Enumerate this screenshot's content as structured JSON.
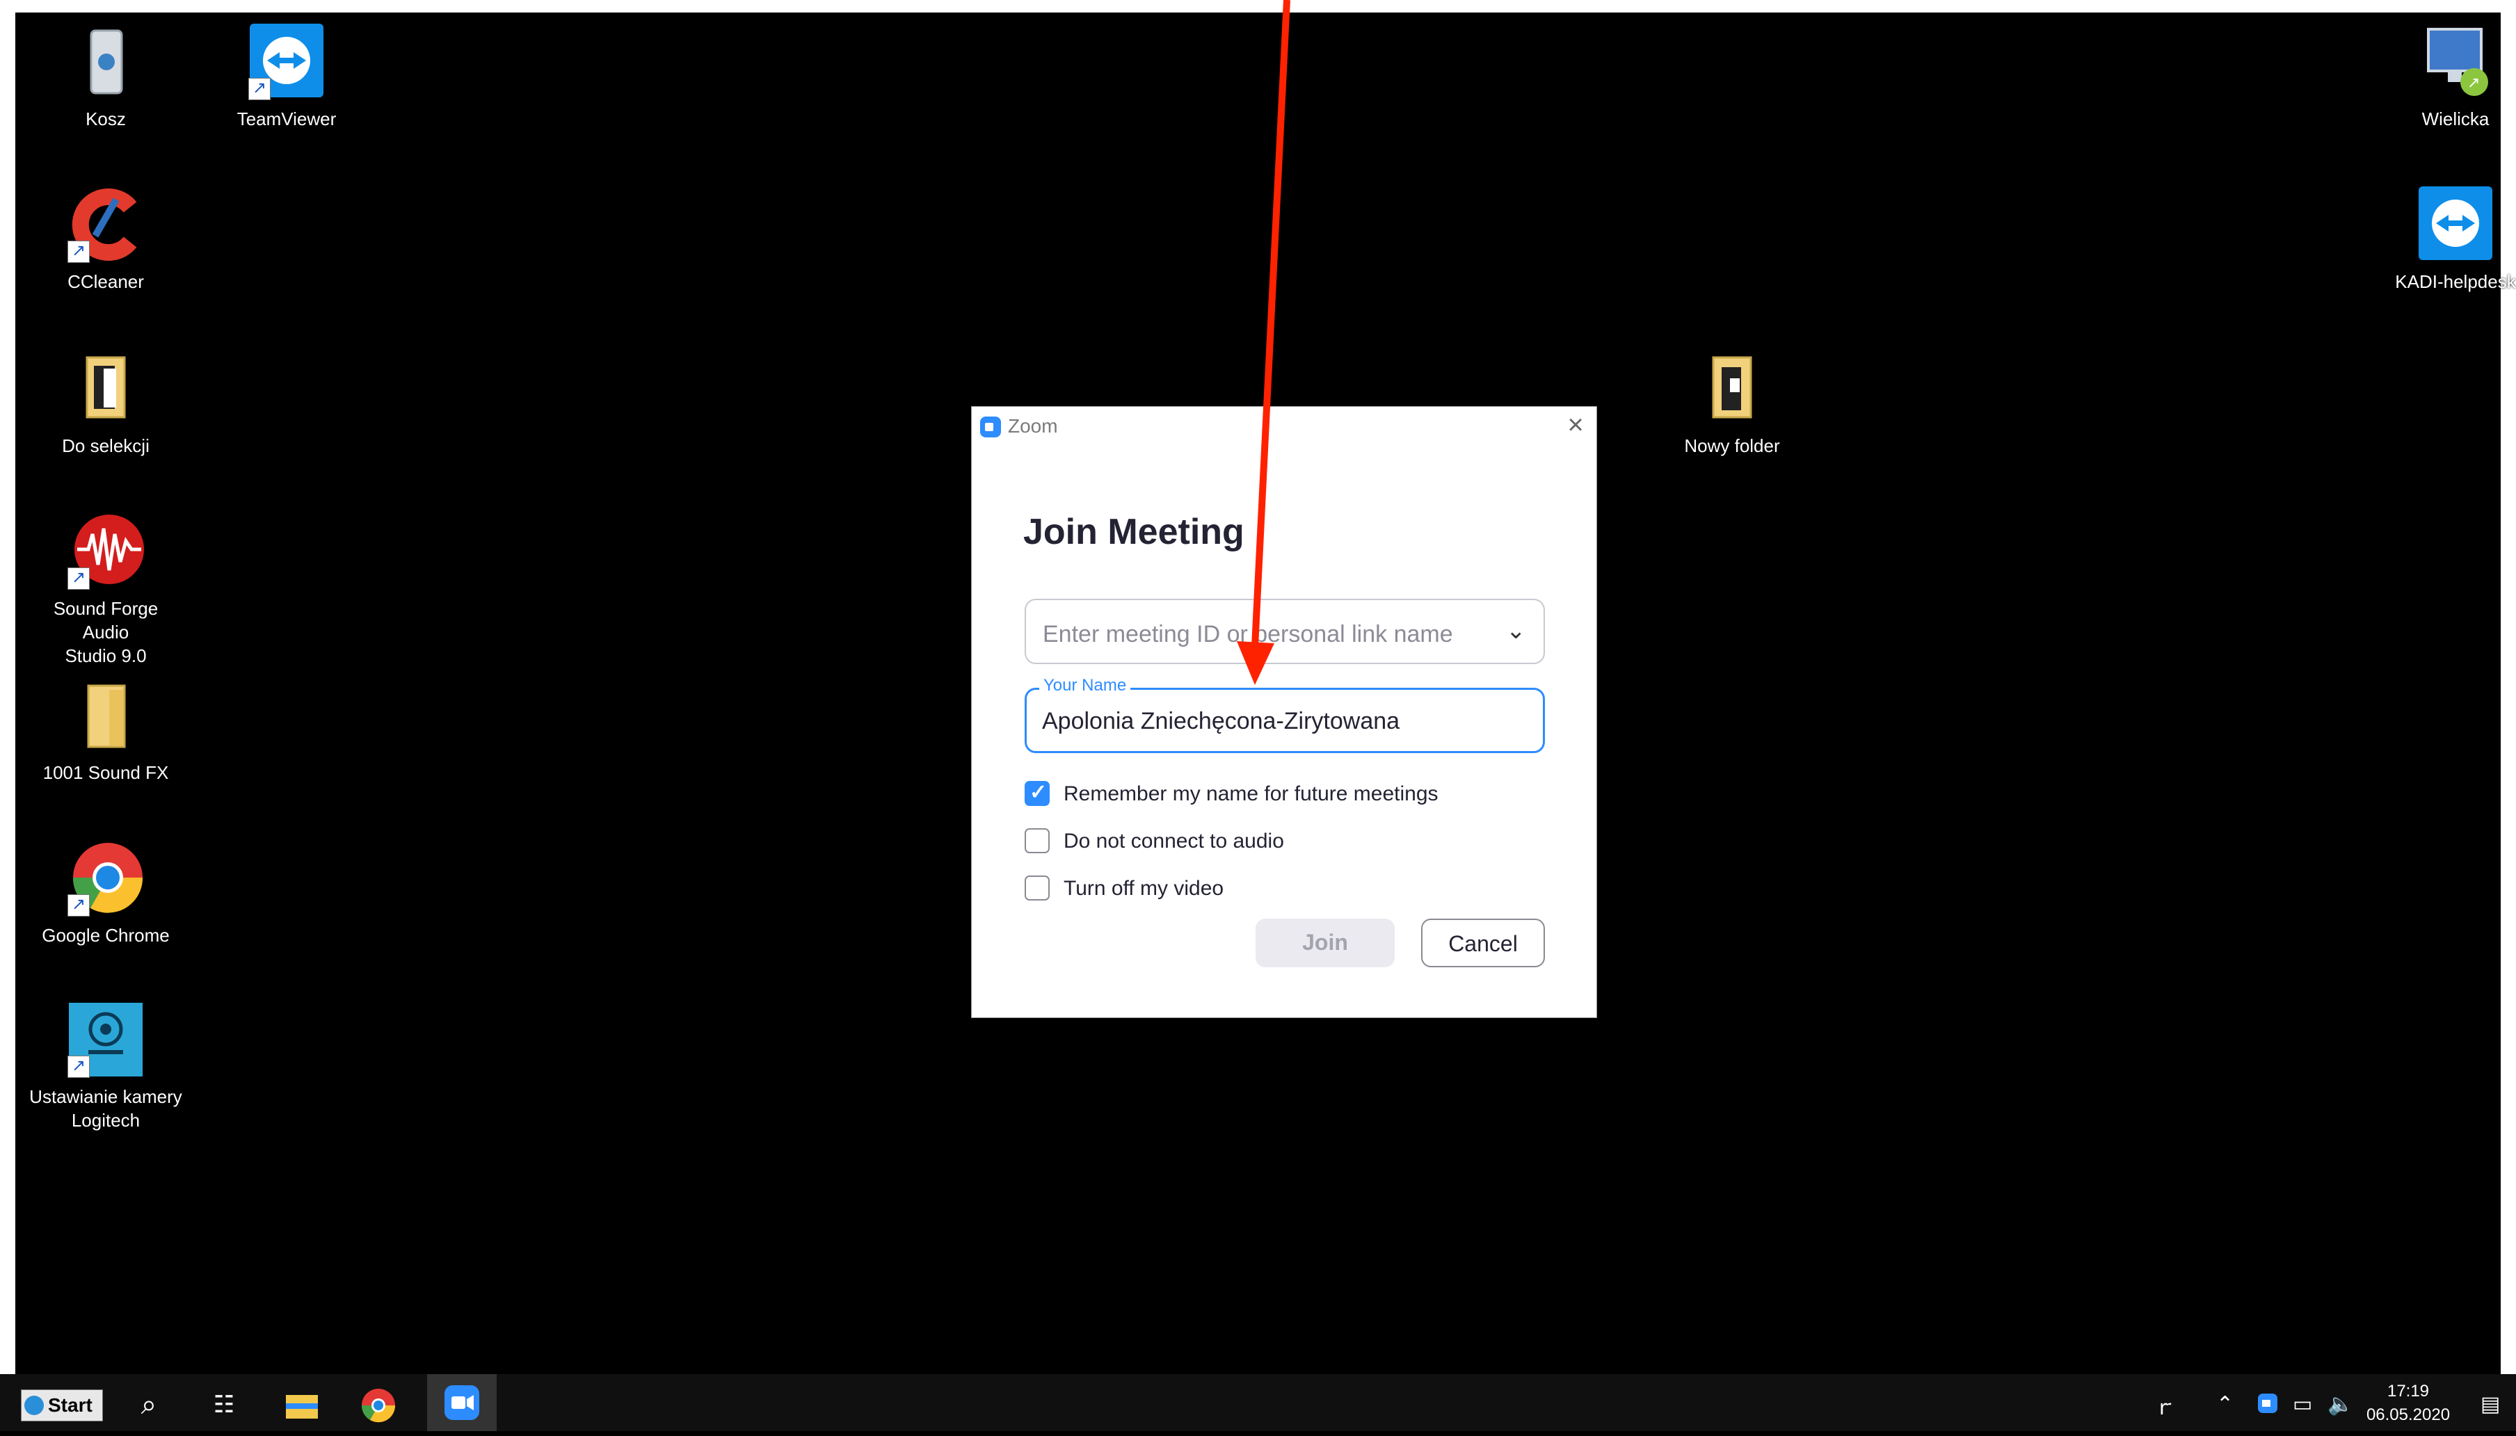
{
  "desktop": {
    "left_icons": [
      {
        "label": "Kosz"
      },
      {
        "label": "TeamViewer"
      },
      {
        "label": "CCleaner"
      },
      {
        "label": "Do selekcji"
      },
      {
        "label": "Sound Forge Audio\nStudio 9.0"
      },
      {
        "label": "1001 Sound FX"
      },
      {
        "label": "Google Chrome"
      },
      {
        "label": "Ustawianie kamery\nLogitech"
      }
    ],
    "right_icons": [
      {
        "label": "Wielicka"
      },
      {
        "label": "KADI-helpdesk"
      }
    ],
    "middle_icons": [
      {
        "label": "Nowy folder"
      }
    ]
  },
  "dialog": {
    "window_title": "Zoom",
    "heading": "Join Meeting",
    "meeting_id_placeholder": "Enter meeting ID or personal link name",
    "name_legend": "Your Name",
    "name_value": "Apolonia Zniechęcona-Zirytowana",
    "checkboxes": [
      {
        "label": "Remember my name for future meetings",
        "checked": true
      },
      {
        "label": "Do not connect to audio",
        "checked": false
      },
      {
        "label": "Turn off my video",
        "checked": false
      }
    ],
    "join_label": "Join",
    "cancel_label": "Cancel"
  },
  "annotation": {
    "color": "#ff2200"
  },
  "taskbar": {
    "start_label": "Start",
    "time": "17:19",
    "date": "06.05.2020"
  },
  "colors": {
    "accent": "#2d8cff"
  }
}
